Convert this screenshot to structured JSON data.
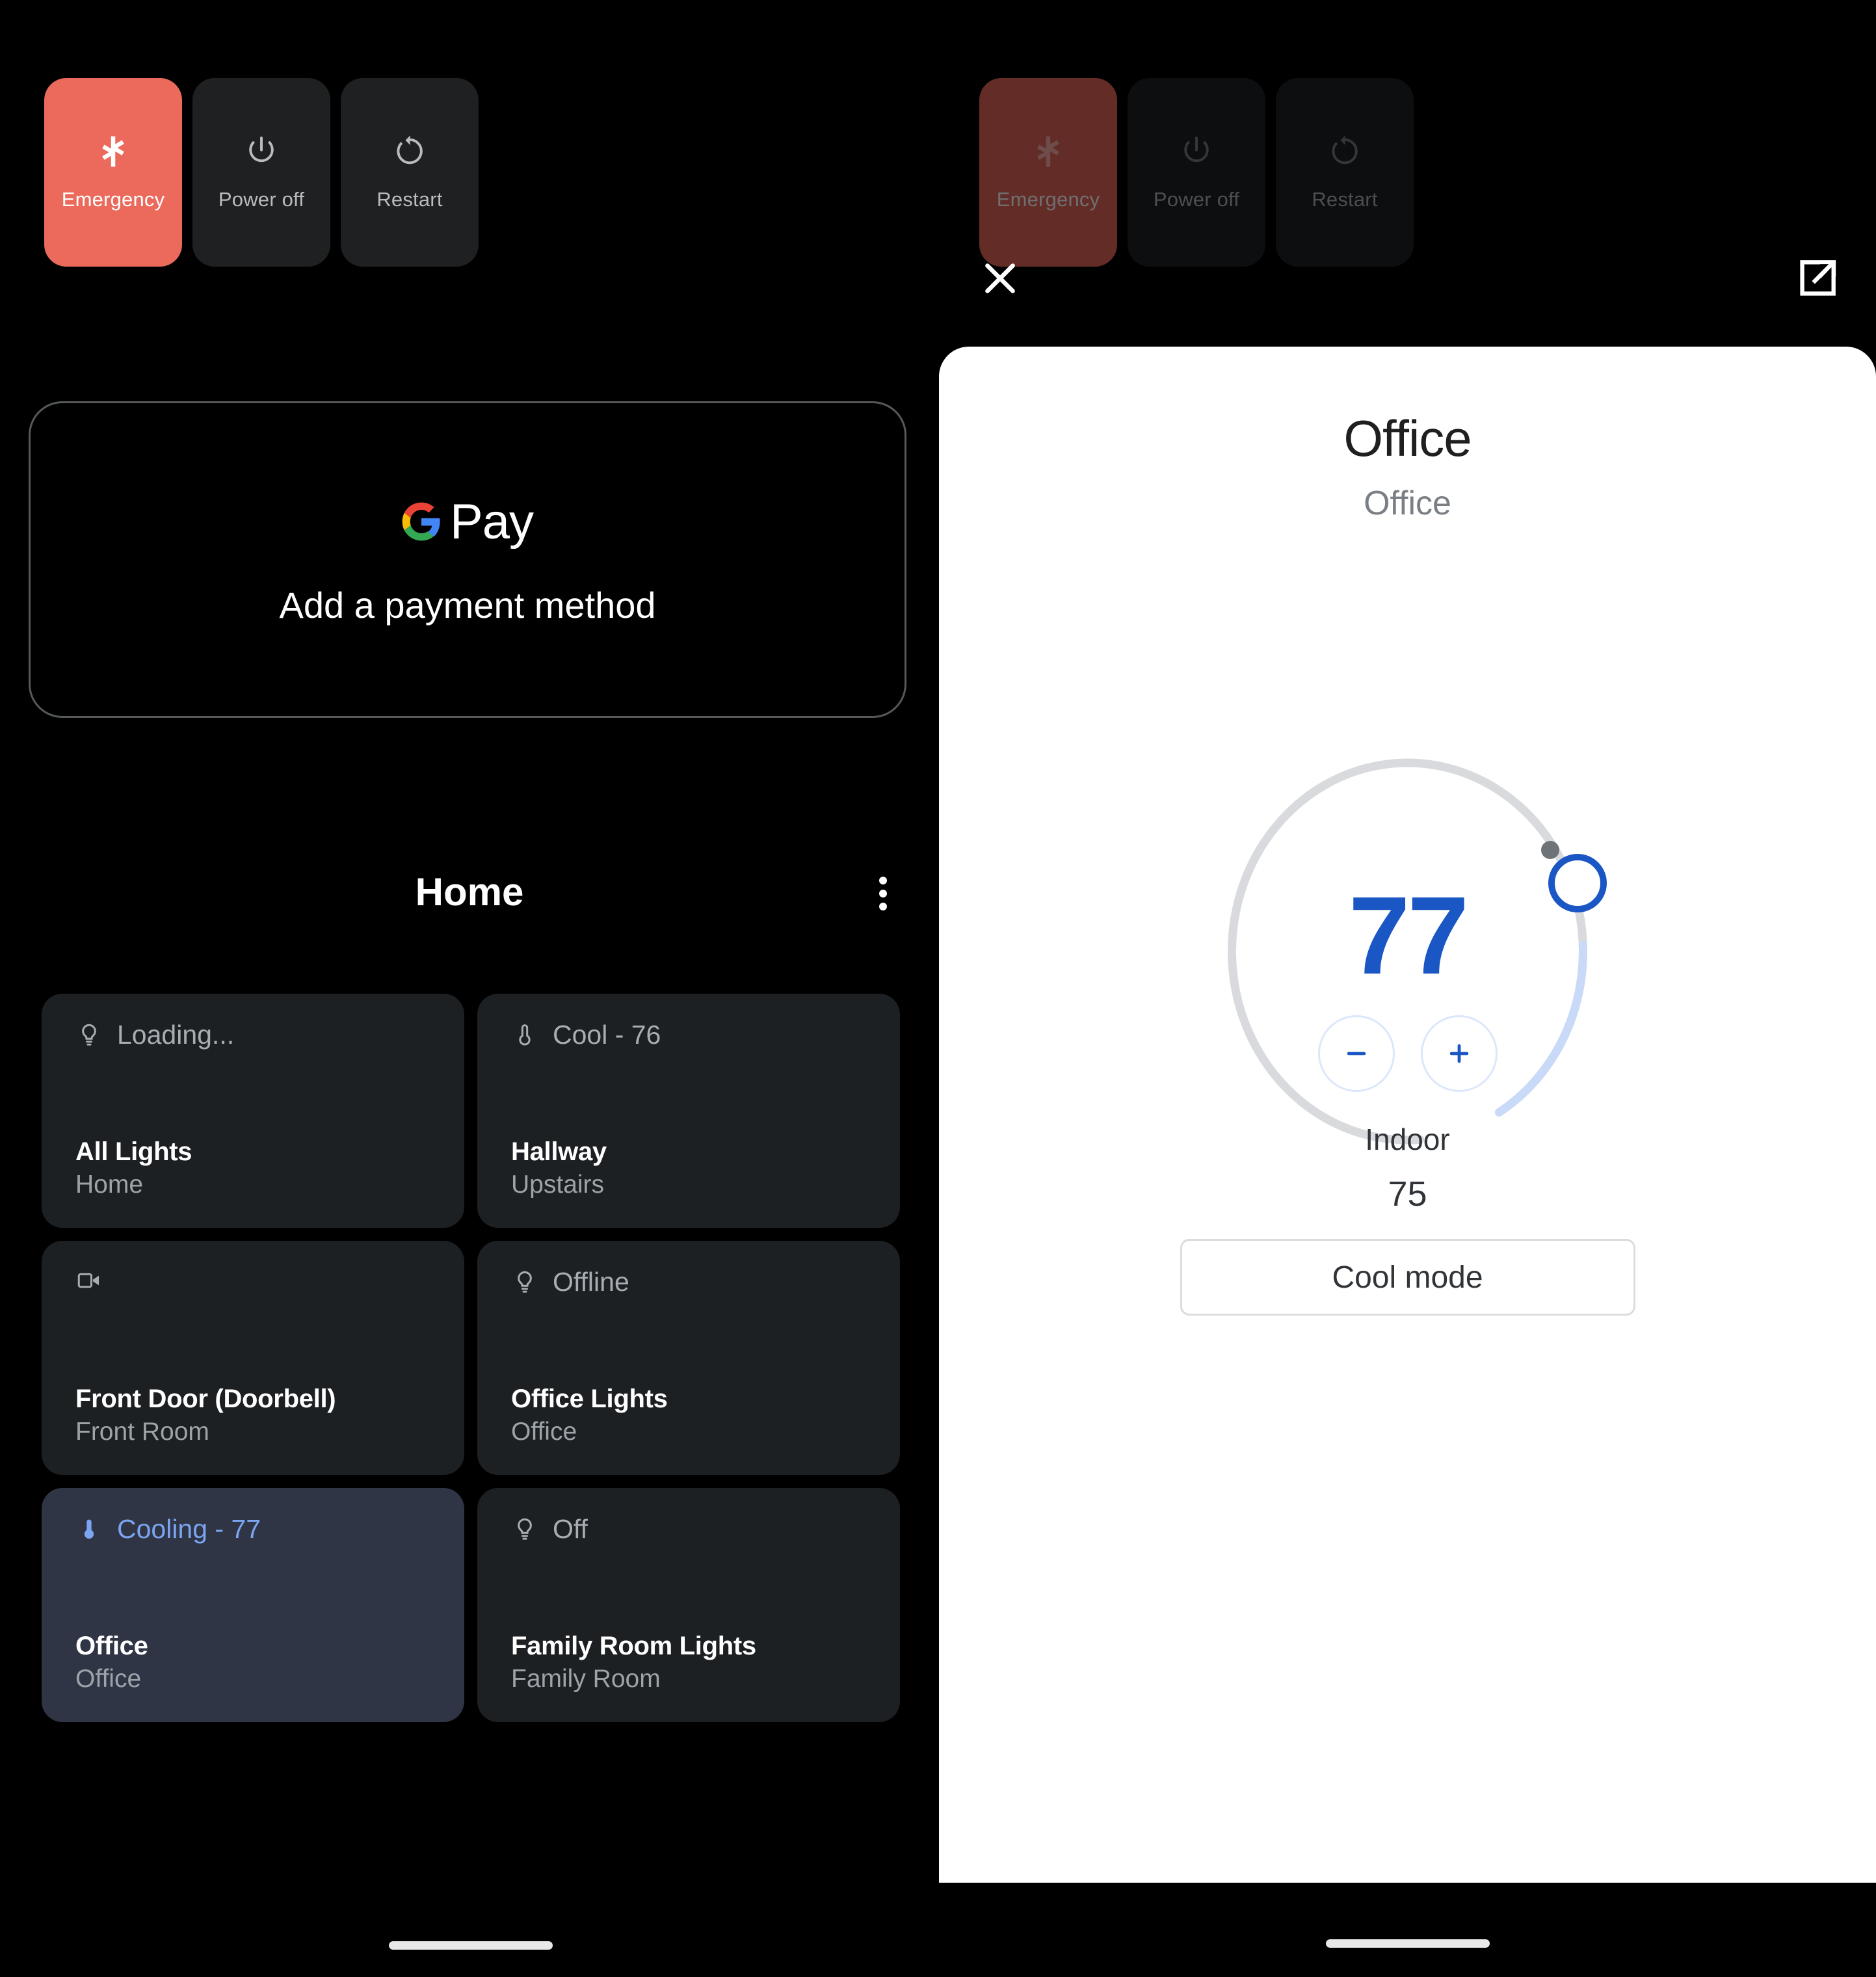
{
  "power_menu": {
    "buttons": [
      {
        "label": "Emergency",
        "icon": "emergency-star-icon",
        "state": "highlighted"
      },
      {
        "label": "Power off",
        "icon": "power-icon",
        "state": "normal"
      },
      {
        "label": "Restart",
        "icon": "restart-icon",
        "state": "normal"
      }
    ],
    "emergency_color": "#ec6a5c",
    "emergency_dimmed_color": "#642c27",
    "button_color": "#1e2022"
  },
  "gpay_card": {
    "logo_word": "Pay",
    "logo_icon": "google-g-icon",
    "action_label": "Add a payment method"
  },
  "home_section": {
    "title": "Home",
    "overflow_icon": "kebab-menu-icon",
    "tiles": [
      {
        "status": "Loading...",
        "icon": "lightbulb-icon",
        "name": "All Lights",
        "room": "Home",
        "active": false
      },
      {
        "status": "Cool - 76",
        "icon": "thermostat-icon",
        "name": "Hallway",
        "room": "Upstairs",
        "active": false
      },
      {
        "status": "",
        "icon": "camera-icon",
        "name": "Front Door (Doorbell)",
        "room": "Front Room",
        "active": false
      },
      {
        "status": "Offline",
        "icon": "lightbulb-icon",
        "name": "Office Lights",
        "room": "Office",
        "active": false
      },
      {
        "status": "Cooling - 77",
        "icon": "thermostat-icon",
        "name": "Office",
        "room": "Office",
        "active": true
      },
      {
        "status": "Off",
        "icon": "lightbulb-icon",
        "name": "Family Room Lights",
        "room": "Family Room",
        "active": false
      }
    ],
    "active_tile_color": "#2f3545",
    "active_status_color": "#7ba5f0"
  },
  "overlay": {
    "close_icon": "close-x-icon",
    "open_external_icon": "open-in-new-icon"
  },
  "thermostat_sheet": {
    "title": "Office",
    "subtitle": "Office",
    "target_temp": "77",
    "target_temp_color": "#1a56c4",
    "decrease_label": "−",
    "increase_label": "+",
    "decrease_icon": "minus-icon",
    "increase_icon": "plus-icon",
    "indoor_label": "Indoor",
    "indoor_value": "75",
    "mode_button_label": "Cool mode",
    "arc": {
      "track_color": "#d8dadd",
      "progress_color": "#c8daf8",
      "handle_stroke": "#1a56c4",
      "marker_color": "#6e7377"
    }
  }
}
